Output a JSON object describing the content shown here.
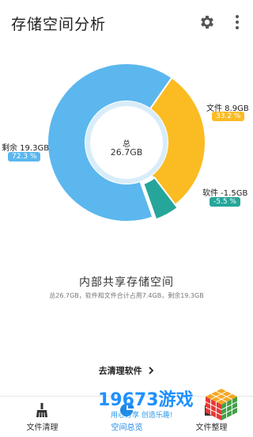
{
  "app": {
    "title": "存储空间分析"
  },
  "toolbar": {
    "settings_icon": "gear-icon",
    "more_icon": "more-vert-icon"
  },
  "chart_data": {
    "type": "pie",
    "categories": [
      "剩余",
      "文件",
      "软件"
    ],
    "values": [
      19.3,
      8.9,
      -1.5
    ],
    "labels": [
      "剩余 19.3GB",
      "文件 8.9GB",
      "软件 -1.5GB"
    ],
    "percents": [
      "72.3 %",
      "33.2 %",
      "-5.5 %"
    ],
    "colors": [
      "#5bb7ee",
      "#fbbb22",
      "#26a69a"
    ],
    "center_label": "总",
    "center_value": "26.7GB"
  },
  "storage": {
    "title": "内部共享存储空间",
    "summary": "总26.7GB，软件和文件合计占用7.4GB，剩余19.3GB"
  },
  "clean_link": {
    "label": "去清理软件",
    "icon": "chevron-right-icon"
  },
  "bottom_nav": [
    {
      "label": "文件清理",
      "icon": "broom-icon",
      "active": false
    },
    {
      "label": "空间总览",
      "icon": "pie-chart-icon",
      "active": true
    },
    {
      "label": "文件整理",
      "icon": "folder-icon",
      "active": false
    }
  ],
  "watermark": {
    "main": "19673游戏",
    "sub": "用心分享 创造乐趣!"
  }
}
